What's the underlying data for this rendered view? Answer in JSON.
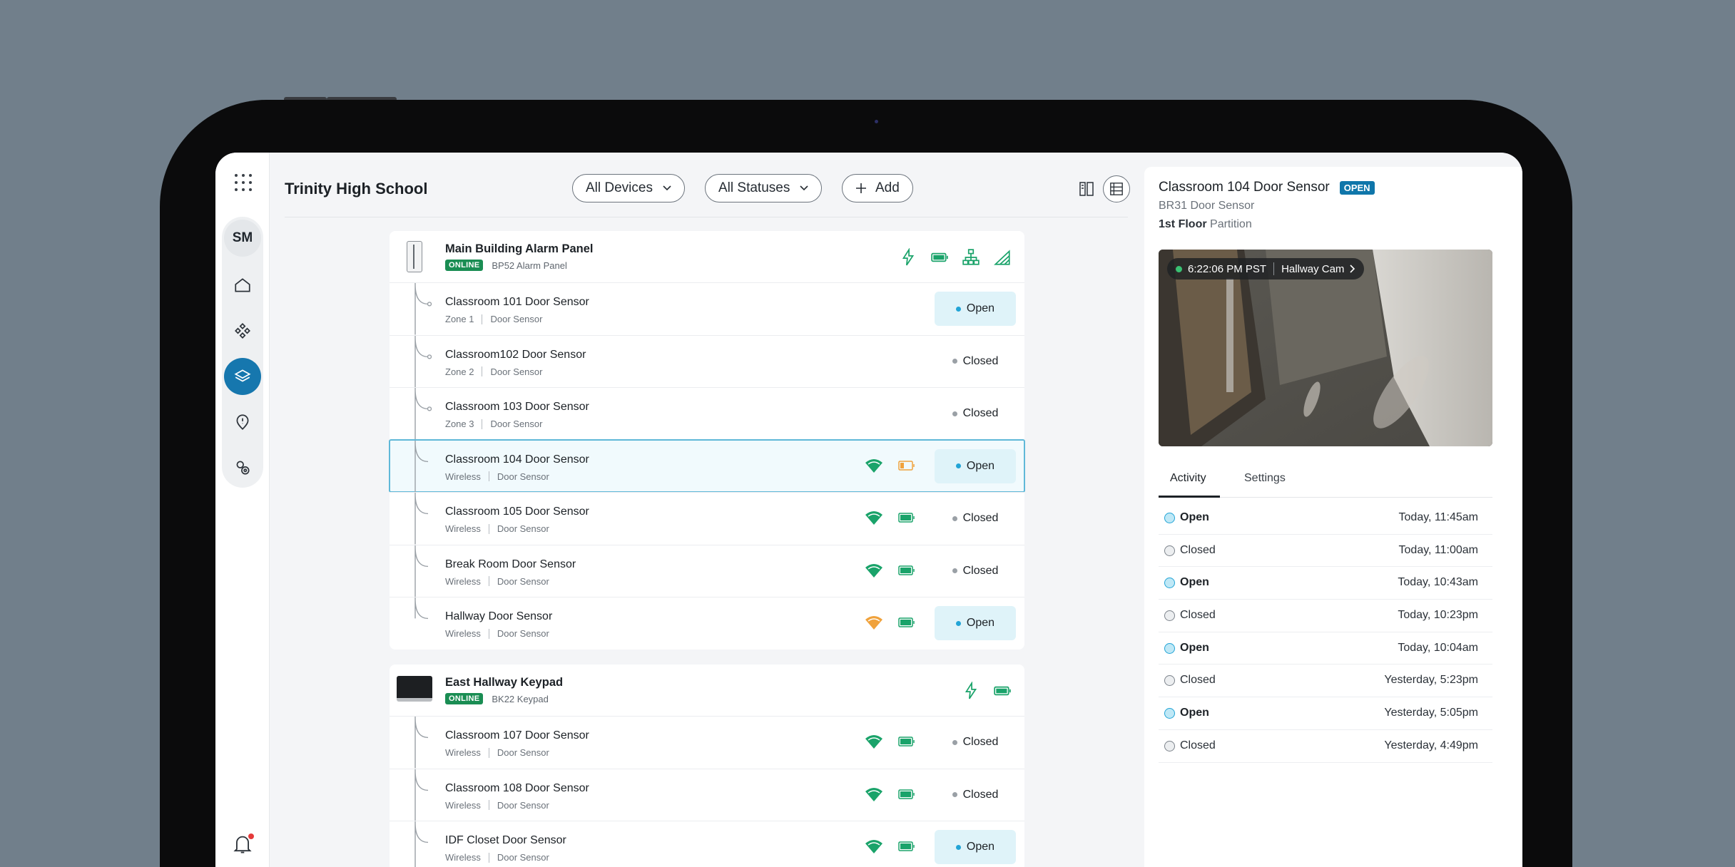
{
  "header": {
    "title": "Trinity High School",
    "filter_devices": "All Devices",
    "filter_statuses": "All Statuses",
    "add_label": "Add"
  },
  "sidebar": {
    "avatar_initials": "SM",
    "items": [
      "home-icon",
      "devices-icon",
      "security-icon",
      "alerts-icon",
      "settings-icon"
    ],
    "active_item": "security-icon",
    "accent": "#1677ae"
  },
  "panels": [
    {
      "name": "Main Building Alarm Panel",
      "status": "ONLINE",
      "model": "BP52 Alarm Panel",
      "sensors": [
        {
          "name": "Classroom 101 Door Sensor",
          "zone": "Zone 1",
          "type": "Door Sensor",
          "state": "Open"
        },
        {
          "name": "Classroom102  Door Sensor",
          "zone": "Zone 2",
          "type": "Door Sensor",
          "state": "Closed"
        },
        {
          "name": "Classroom 103 Door Sensor",
          "zone": "Zone 3",
          "type": "Door Sensor",
          "state": "Closed"
        },
        {
          "name": "Classroom 104 Door Sensor",
          "zone": "Wireless",
          "type": "Door Sensor",
          "state": "Open"
        },
        {
          "name": "Classroom 105 Door Sensor",
          "zone": "Wireless",
          "type": "Door Sensor",
          "state": "Closed"
        },
        {
          "name": "Break Room Door Sensor",
          "zone": "Wireless",
          "type": "Door Sensor",
          "state": "Closed"
        },
        {
          "name": "Hallway Door Sensor",
          "zone": "Wireless",
          "type": "Door Sensor",
          "state": "Open"
        }
      ]
    },
    {
      "name": "East Hallway Keypad",
      "status": "ONLINE",
      "model": "BK22 Keypad",
      "sensors": [
        {
          "name": "Classroom 107 Door Sensor",
          "zone": "Wireless",
          "type": "Door Sensor",
          "state": "Closed"
        },
        {
          "name": "Classroom 108 Door Sensor",
          "zone": "Wireless",
          "type": "Door Sensor",
          "state": "Closed"
        },
        {
          "name": "IDF Closet Door Sensor",
          "zone": "Wireless",
          "type": "Door Sensor",
          "state": "Open"
        }
      ]
    }
  ],
  "detail": {
    "title": "Classroom 104 Door Sensor",
    "badge": "OPEN",
    "model": "BR31 Door Sensor",
    "floor": "1st Floor",
    "partition": "Partition",
    "camera": {
      "time": "6:22:06 PM PST",
      "name": "Hallway Cam"
    },
    "tabs": [
      "Activity",
      "Settings"
    ],
    "activity": [
      {
        "state": "Open",
        "time": "Today, 11:45am"
      },
      {
        "state": "Closed",
        "time": "Today, 11:00am"
      },
      {
        "state": "Open",
        "time": "Today, 10:43am"
      },
      {
        "state": "Closed",
        "time": "Today, 10:23pm"
      },
      {
        "state": "Open",
        "time": "Today, 10:04am"
      },
      {
        "state": "Closed",
        "time": "Yesterday, 5:23pm"
      },
      {
        "state": "Open",
        "time": "Yesterday, 5:05pm"
      },
      {
        "state": "Closed",
        "time": "Yesterday, 4:49pm"
      }
    ]
  },
  "colors": {
    "online": "#1a8d53",
    "open_badge": "#0f76aa",
    "wifi_good": "#1aa36a",
    "wifi_weak": "#f0a23c",
    "battery_good": "#1aa36a",
    "battery_low": "#f0a23c"
  }
}
